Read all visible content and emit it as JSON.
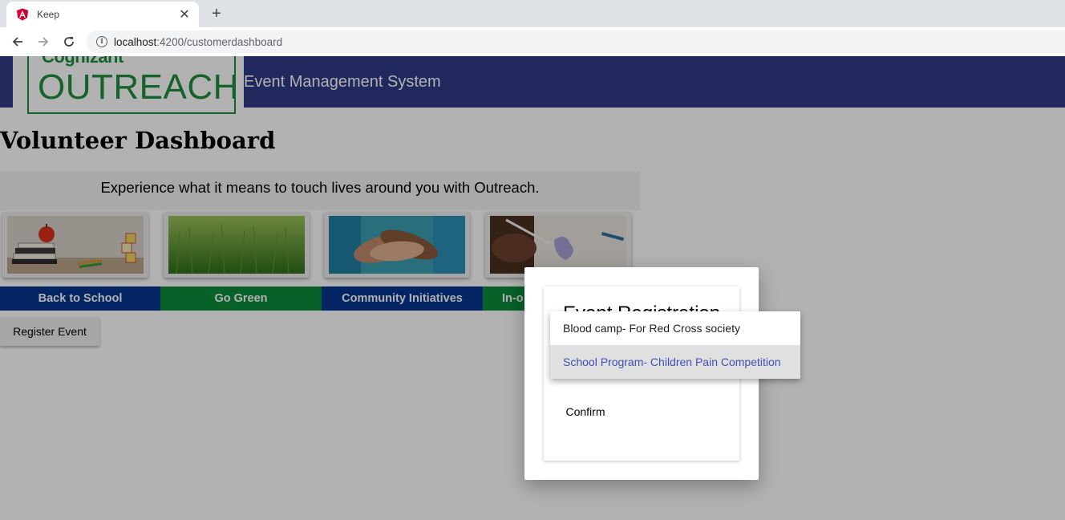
{
  "browser": {
    "tab_title": "Keep",
    "url_host": "localhost",
    "url_path": ":4200/customerdashboard"
  },
  "header": {
    "logo_small": "Cognizant",
    "logo_big": "OUTREACH",
    "app_title": "Event Management System"
  },
  "page": {
    "heading": "Volunteer Dashboard",
    "tagline": "Experience what it means to touch lives around you with Outreach.",
    "register_label": "Register Event"
  },
  "categories": [
    {
      "label": "Back to School",
      "color": "#07358e"
    },
    {
      "label": "Go Green",
      "color": "#0b8b3b"
    },
    {
      "label": "Community Initiatives",
      "color": "#07358e"
    },
    {
      "label": "In-o",
      "color": "#0b8b3b"
    }
  ],
  "dialog": {
    "title": "Event Registration",
    "confirm_label": "Confirm"
  },
  "select": {
    "options": [
      {
        "label": "Blood camp- For Red Cross society",
        "selected": false
      },
      {
        "label": "School Program- Children Pain Competition",
        "selected": true
      }
    ]
  },
  "colors": {
    "header_bg": "#2f3a86",
    "logo_green": "#1f8e3d",
    "selected_option": "#3f51b5"
  }
}
